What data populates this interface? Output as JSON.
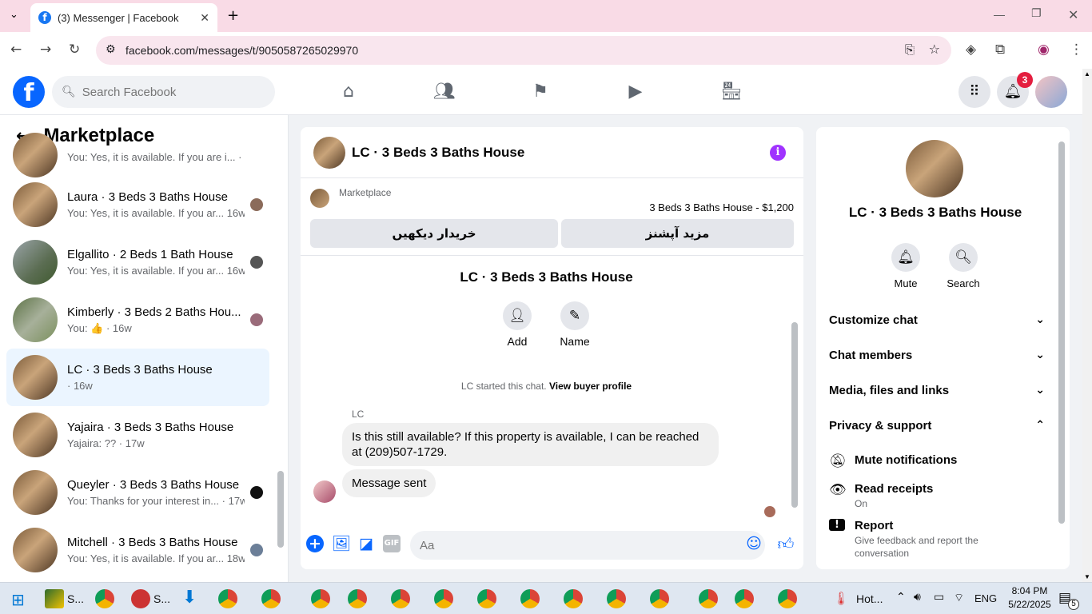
{
  "browser": {
    "tab_title": "(3) Messenger | Facebook",
    "url": "facebook.com/messages/t/9050587265029970"
  },
  "fb": {
    "search_placeholder": "Search Facebook",
    "notif_count": "3"
  },
  "left": {
    "title": "Marketplace",
    "conversations": [
      {
        "name": "",
        "preview": "You: Yes, it is available. If you are i... · 16w"
      },
      {
        "name": "Laura · 3 Beds 3 Baths House",
        "preview": "You: Yes, it is available. If you ar... 16w"
      },
      {
        "name": "Elgallito · 2 Beds 1 Bath House",
        "preview": "You: Yes, it is available. If you ar... 16w"
      },
      {
        "name": "Kimberly · 3 Beds 2 Baths Hou...",
        "preview": "You: 👍 · 16w"
      },
      {
        "name": "LC · 3 Beds 3 Baths House",
        "preview": "· 16w"
      },
      {
        "name": "Yajaira · 3 Beds 3 Baths House",
        "preview": "Yajaira: ?? · 17w"
      },
      {
        "name": "Queyler · 3 Beds 3 Baths House",
        "preview": "You: Thanks for your interest in... · 17w"
      },
      {
        "name": "Mitchell · 3 Beds 3 Baths House",
        "preview": "You: Yes, it is available. If you ar... 18w"
      }
    ]
  },
  "chat": {
    "title": "LC · 3 Beds 3 Baths House",
    "marketplace_label": "Marketplace",
    "listing": "3 Beds 3 Baths House - $1,200",
    "btn_left": "خریدار دیکھیں",
    "btn_right": "مزید آپشنز",
    "thread_name": "LC · 3 Beds 3 Baths House",
    "add_label": "Add",
    "name_label": "Name",
    "started_text": "LC started this chat.",
    "view_profile": "View buyer profile",
    "sender": "LC",
    "message1": "Is this still available? If this property is available, I can be reached at (209)507-1729.",
    "message2": "Message sent",
    "composer_placeholder": "Aa"
  },
  "right": {
    "name": "LC · 3 Beds 3 Baths House",
    "mute": "Mute",
    "search": "Search",
    "sections": [
      "Customize chat",
      "Chat members",
      "Media, files and links",
      "Privacy & support"
    ],
    "mute_notifications": "Mute notifications",
    "read_receipts": "Read receipts",
    "read_receipts_value": "On",
    "report": "Report",
    "report_desc": "Give feedback and report the conversation"
  },
  "taskbar": {
    "s1": "S...",
    "s2": "S...",
    "weather": "Hot...",
    "lang": "ENG",
    "time": "8:04 PM",
    "date": "5/22/2025",
    "notif": "5"
  },
  "icons": {
    "messenger_blue": "#0866ff",
    "info_purple": "#a033ff",
    "badge_red": "#e41e3f"
  }
}
